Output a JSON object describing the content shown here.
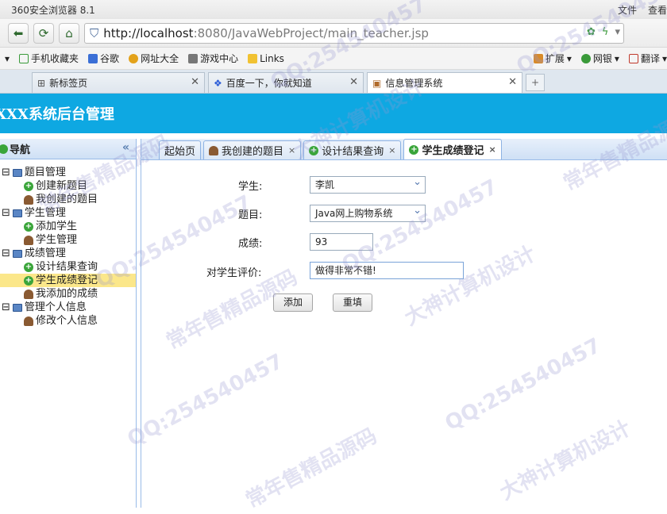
{
  "browser": {
    "title": "360安全浏览器 8.1",
    "menu": [
      "文件",
      "查看"
    ],
    "url_host": "http://localhost",
    "url_rest": ":8080/JavaWebProject/main_teacher.jsp",
    "favorites": [
      "手机收藏夹",
      "谷歌",
      "网址大全",
      "游戏中心",
      "Links"
    ],
    "fav_right": [
      "扩展",
      "网银",
      "翻译"
    ],
    "tabs": [
      {
        "label": "新标签页"
      },
      {
        "label": "百度一下，你就知道"
      },
      {
        "label": "信息管理系统"
      }
    ]
  },
  "app": {
    "banner": "XXX系统后台管理"
  },
  "sidebar": {
    "title": "导航",
    "groups": [
      {
        "label": "题目管理",
        "items": [
          "创建新题目",
          "我创建的题目"
        ]
      },
      {
        "label": "学生管理",
        "items": [
          "添加学生",
          "学生管理"
        ]
      },
      {
        "label": "成绩管理",
        "items": [
          "设计结果查询",
          "学生成绩登记",
          "我添加的成绩"
        ]
      },
      {
        "label": "管理个人信息",
        "items": [
          "修改个人信息"
        ]
      }
    ]
  },
  "content_tabs": [
    "起始页",
    "我创建的题目",
    "设计结果查询",
    "学生成绩登记"
  ],
  "form": {
    "student_label": "学生:",
    "student_value": "李凯",
    "topic_label": "题目:",
    "topic_value": "Java网上购物系统",
    "score_label": "成绩:",
    "score_value": "93",
    "comment_label": "对学生评价:",
    "comment_value": "做得非常不错!",
    "add_button": "添加",
    "reset_button": "重填"
  },
  "watermarks": [
    "QQ:254540457",
    "常年售精品源码",
    "大神计算机设计"
  ]
}
